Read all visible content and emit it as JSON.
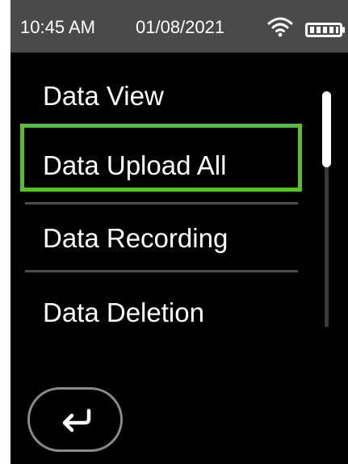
{
  "status_bar": {
    "time": "10:45 AM",
    "date": "01/08/2021",
    "wifi_icon": "wifi-icon",
    "battery_icon": "battery-icon"
  },
  "menu": {
    "items": [
      {
        "label": "Data View"
      },
      {
        "label": "Data Upload All"
      },
      {
        "label": "Data Recording"
      },
      {
        "label": "Data Deletion"
      }
    ],
    "selected_item": "Data Upload All"
  },
  "navigation": {
    "back_icon": "return-arrow-icon"
  },
  "colors": {
    "background": "#000000",
    "status_bar": "#4a4a4a",
    "selection": "#56c12c",
    "text": "#ffffff"
  }
}
